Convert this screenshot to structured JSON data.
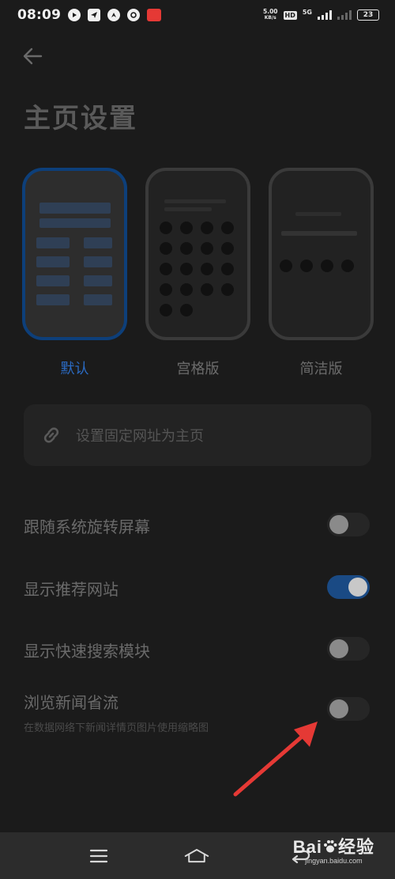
{
  "status_bar": {
    "time": "08:09",
    "speed_value": "5.00",
    "speed_unit": "KB/s",
    "hd": "HD",
    "network": "5G",
    "battery": "23"
  },
  "header": {
    "title": "主页设置"
  },
  "layouts": {
    "options": [
      {
        "label": "默认",
        "selected": true
      },
      {
        "label": "宫格版",
        "selected": false
      },
      {
        "label": "简洁版",
        "selected": false
      }
    ]
  },
  "homepage_url": {
    "placeholder": "设置固定网址为主页",
    "icon": "link-icon"
  },
  "settings": [
    {
      "title": "跟随系统旋转屏幕",
      "enabled": false
    },
    {
      "title": "显示推荐网站",
      "enabled": true
    },
    {
      "title": "显示快速搜索模块",
      "enabled": false
    },
    {
      "title": "浏览新闻省流",
      "subtitle": "在数据网络下新闻详情页图片使用缩略图",
      "enabled": false
    }
  ],
  "colors": {
    "accent": "#2b6bc4",
    "annotation_arrow": "#e53935"
  },
  "watermark": {
    "brand": "Bai",
    "brand_suffix": "经验",
    "url": "jingyan.baidu.com"
  }
}
